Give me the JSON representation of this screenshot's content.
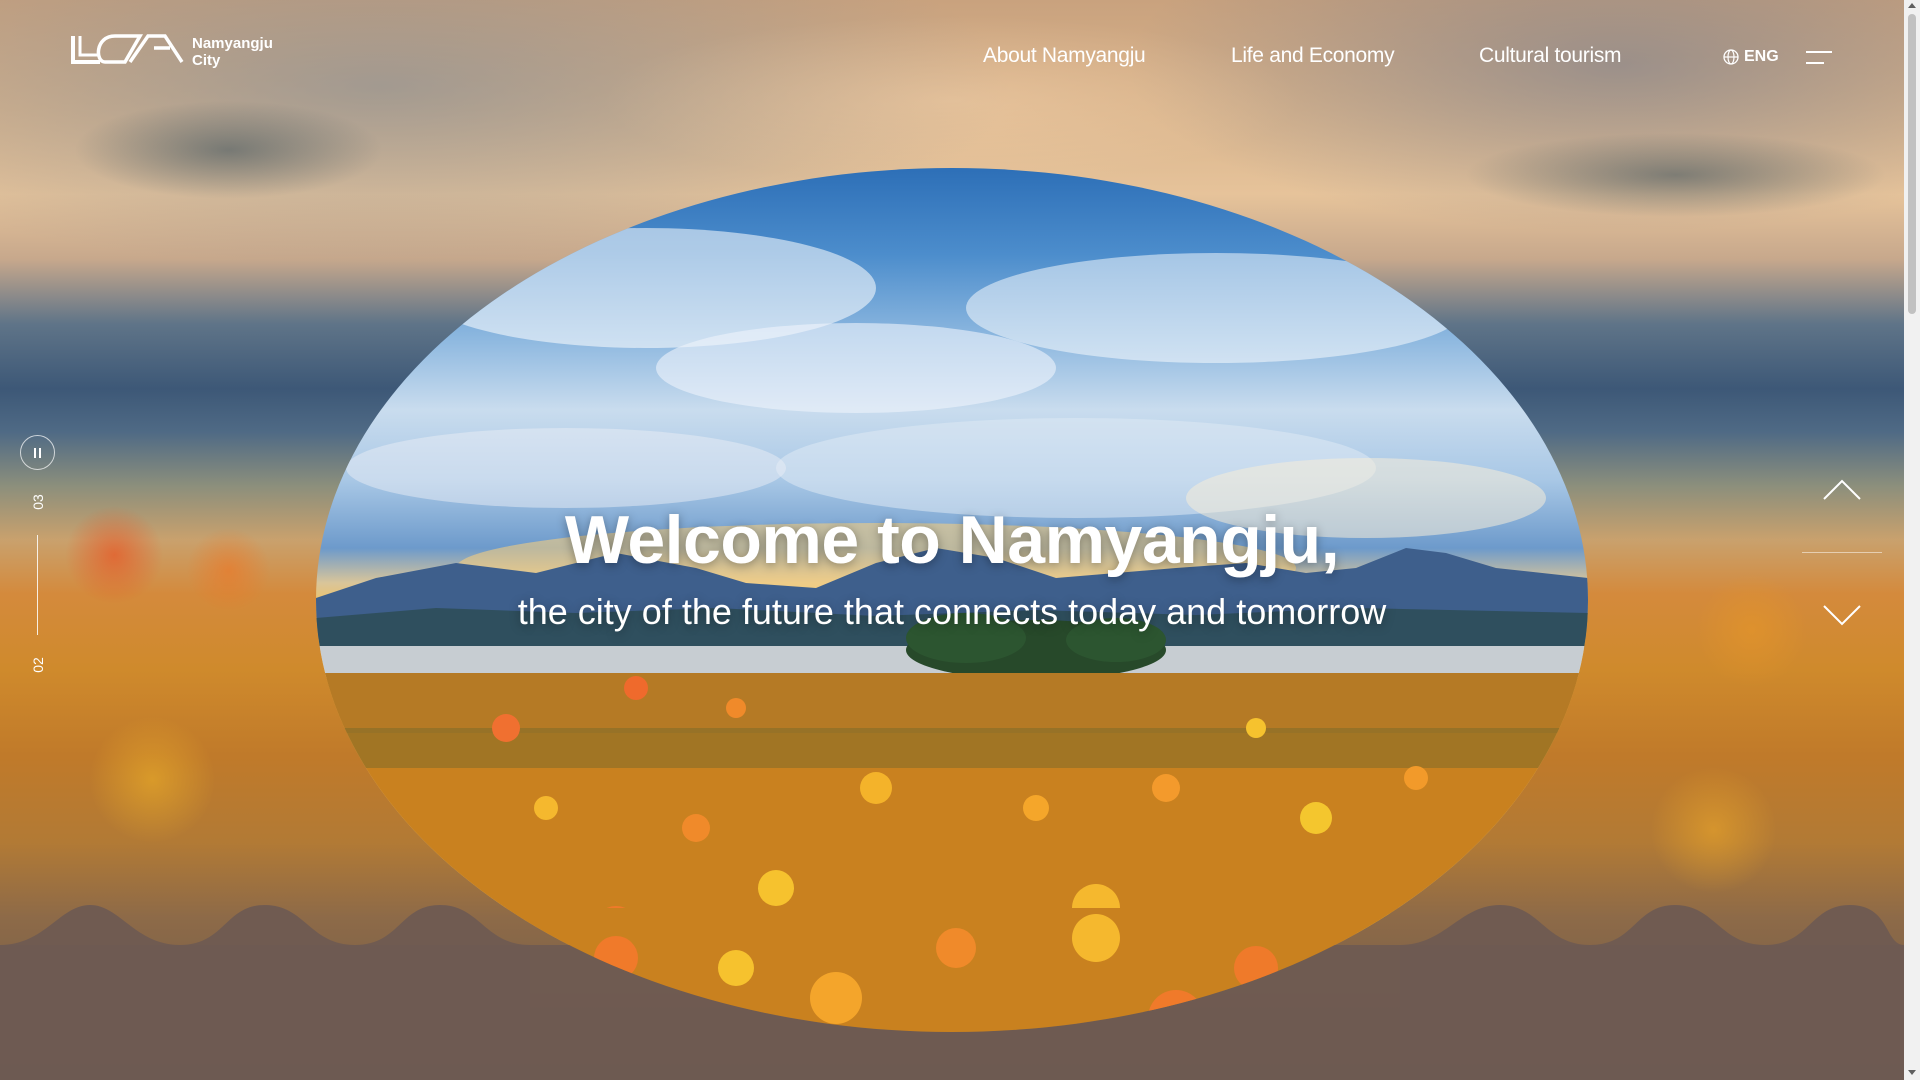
{
  "header": {
    "logo_line1": "Namyangju",
    "logo_line2": "City",
    "nav": [
      {
        "label": "About Namyangju"
      },
      {
        "label": "Life and Economy"
      },
      {
        "label": "Cultural tourism"
      }
    ],
    "language": "ENG",
    "menu_icon": "hamburger-menu-icon"
  },
  "hero": {
    "title": "Welcome to Namyangju,",
    "subtitle": "the city of the future that connects today and tomorrow"
  },
  "slider": {
    "current": "03",
    "total": "02",
    "pause_icon": "pause-icon",
    "prev_icon": "chevron-up-icon",
    "next_icon": "chevron-down-icon"
  },
  "colors": {
    "accent": "#ffffff",
    "wave": "#6e5a52"
  }
}
